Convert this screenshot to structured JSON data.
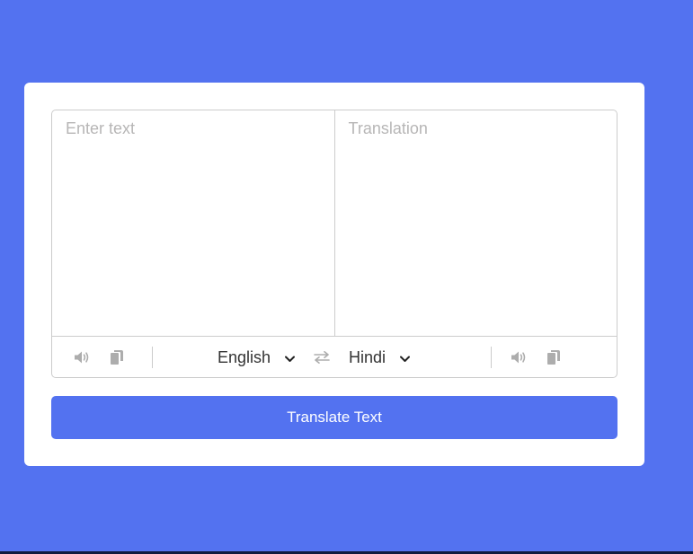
{
  "input": {
    "from_placeholder": "Enter text",
    "to_placeholder": "Translation"
  },
  "controls": {
    "from_language": "English",
    "to_language": "Hindi",
    "icons": {
      "from_speak": "volume-icon",
      "from_copy": "copy-icon",
      "exchange": "exchange-icon",
      "to_speak": "volume-icon",
      "to_copy": "copy-icon",
      "dropdown": "chevron-down-icon"
    }
  },
  "button": {
    "translate_label": "Translate Text"
  },
  "colors": {
    "background": "#5372f0",
    "card": "#ffffff",
    "border": "#cccccc",
    "icon": "#adadad",
    "placeholder": "#b7b6b6"
  }
}
